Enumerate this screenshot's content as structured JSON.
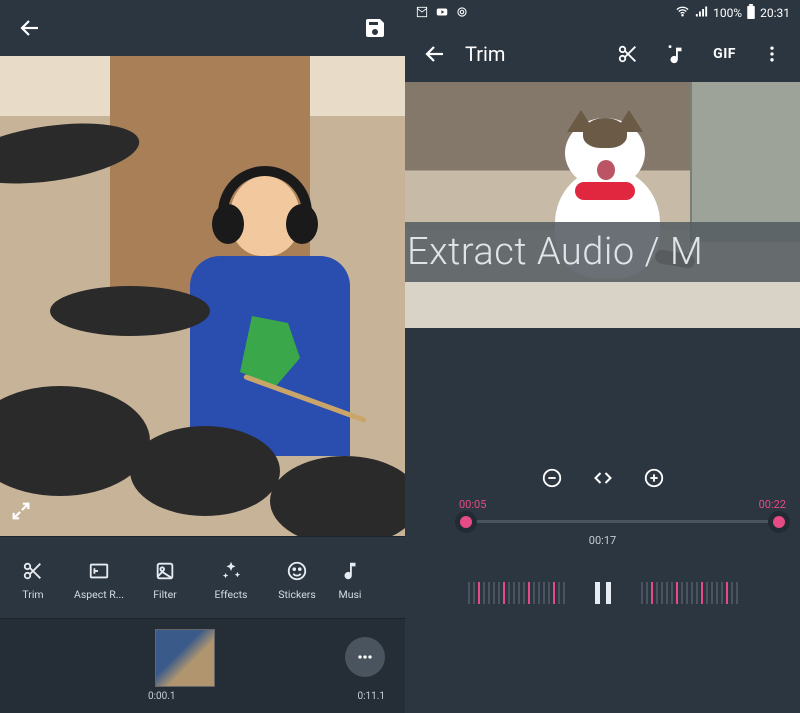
{
  "left": {
    "tools": [
      {
        "label": "Trim",
        "icon": "scissors"
      },
      {
        "label": "Aspect R...",
        "icon": "aspect"
      },
      {
        "label": "Filter",
        "icon": "filter"
      },
      {
        "label": "Effects",
        "icon": "sparkle"
      },
      {
        "label": "Stickers",
        "icon": "smile"
      },
      {
        "label": "Musi",
        "icon": "music"
      }
    ],
    "timeline": {
      "start": "0:00.1",
      "end": "0:11.1"
    }
  },
  "right": {
    "status": {
      "battery": "100%",
      "time": "20:31"
    },
    "title": "Trim",
    "gif_label": "GIF",
    "overlay_text": "Extract Audio / M",
    "trim": {
      "start": "00:05",
      "end": "00:22",
      "duration": "00:17"
    }
  }
}
